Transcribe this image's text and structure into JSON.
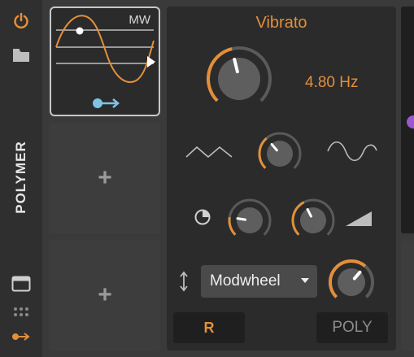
{
  "sidebar": {
    "title": "POLYMER",
    "icons": [
      "power-icon",
      "folder-icon",
      "window-icon",
      "grid-icon",
      "modulator-arrow-icon"
    ]
  },
  "slots": {
    "active": {
      "label": "MW",
      "icons": [
        "waveform-icon",
        "modulation-arrow-icon"
      ]
    },
    "empty_1": {
      "label": "+"
    },
    "empty_2": {
      "label": "+"
    }
  },
  "device": {
    "title": "Vibrato",
    "rate": {
      "value_text": "4.80 Hz",
      "level": 0.45
    },
    "shape_knob": {
      "level": 0.35
    },
    "phase_knob": {
      "level": 0.2
    },
    "slope_knob": {
      "level": 0.4
    },
    "amount_knob": {
      "level": 0.65
    },
    "source_select": {
      "selected": "Modwheel"
    },
    "buttons": {
      "r_label": "R",
      "poly_label": "POLY"
    }
  },
  "colors": {
    "accent": "#e38f3a",
    "panel": "#2b2b2b",
    "background": "#3a3a3a",
    "text": "#e6e6e6",
    "purple": "#9b59d0"
  }
}
